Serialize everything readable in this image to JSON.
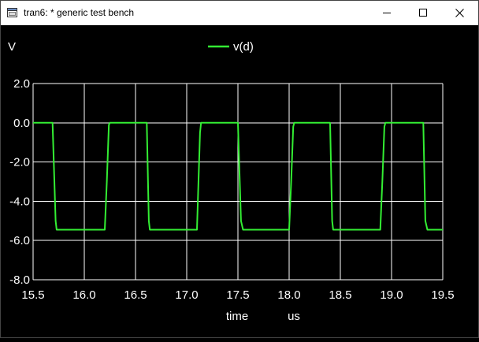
{
  "window": {
    "title": "tran6: * generic test bench",
    "icons": {
      "app": "window-app-icon",
      "minimize": "minimize-icon",
      "maximize": "maximize-icon",
      "close": "close-icon"
    }
  },
  "colors": {
    "background": "#000000",
    "grid": "#ffffff",
    "trace": "#33ee33",
    "text": "#ffffff"
  },
  "chart_data": {
    "type": "line",
    "title": "",
    "ylabel": "V",
    "xlabel": "time",
    "xunit": "us",
    "xlim": [
      15.5,
      19.5
    ],
    "ylim": [
      -8.0,
      2.0
    ],
    "xticks": [
      15.5,
      16.0,
      16.5,
      17.0,
      17.5,
      18.0,
      18.5,
      19.0,
      19.5
    ],
    "xtick_labels": [
      "15.5",
      "16.0",
      "16.5",
      "17.0",
      "17.5",
      "18.0",
      "18.5",
      "19.0",
      "19.5"
    ],
    "yticks": [
      2.0,
      0.0,
      -2.0,
      -4.0,
      -6.0,
      -8.0
    ],
    "ytick_labels": [
      "2.0",
      "0.0",
      "-2.0",
      "-4.0",
      "-6.0",
      "-8.0"
    ],
    "grid": true,
    "legend": "top-center",
    "series": [
      {
        "name": "v(d)",
        "x": [
          15.5,
          15.69,
          15.72,
          15.73,
          16.2,
          16.22,
          16.24,
          16.25,
          16.61,
          16.63,
          16.64,
          17.1,
          17.13,
          17.14,
          17.5,
          17.53,
          17.55,
          18.0,
          18.02,
          18.04,
          18.05,
          18.4,
          18.42,
          18.43,
          18.89,
          18.91,
          18.93,
          18.94,
          19.31,
          19.33,
          19.35,
          19.5
        ],
        "y": [
          0.0,
          0.0,
          -5.0,
          -5.45,
          -5.45,
          -3.0,
          -0.1,
          0.0,
          0.0,
          -5.0,
          -5.45,
          -5.45,
          -0.5,
          0.0,
          0.0,
          -5.0,
          -5.45,
          -5.45,
          -3.0,
          -0.2,
          0.0,
          0.0,
          -5.0,
          -5.45,
          -5.45,
          -3.0,
          -0.2,
          0.0,
          0.0,
          -5.0,
          -5.45,
          -5.45
        ]
      }
    ]
  }
}
